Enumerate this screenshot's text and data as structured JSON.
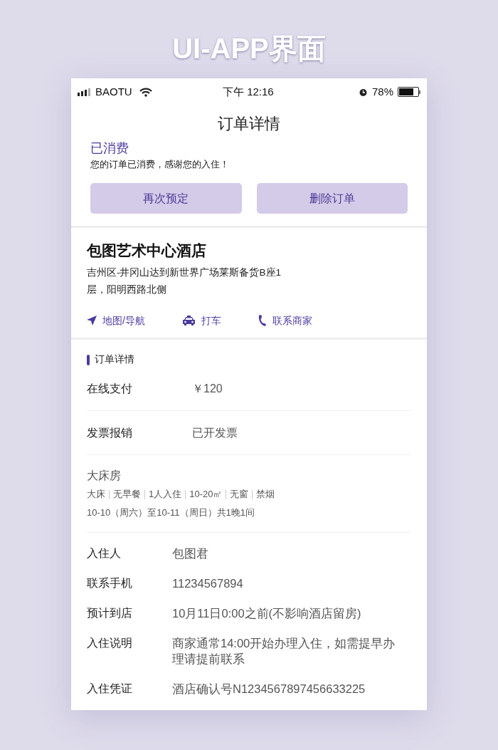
{
  "poster_title": "UI-APP界面",
  "status_bar": {
    "carrier": "BAOTU",
    "time": "下午 12:16",
    "battery": "78%"
  },
  "nav_title": "订单详情",
  "order_status": {
    "title": "已消费",
    "message": "您的订单已消费，感谢您的入住！"
  },
  "buttons": [
    "再次预定",
    "删除订单"
  ],
  "hotel": {
    "name": "包图艺术中心酒店",
    "address": "吉州区-井冈山达到新世界广场莱斯备货B座1层，阳明西路北侧"
  },
  "actions": [
    {
      "kind": "navigate",
      "label": "地图/导航"
    },
    {
      "kind": "taxi",
      "label": "打车"
    },
    {
      "kind": "phone",
      "label": "联系商家"
    }
  ],
  "section_title": "订单详情",
  "payment_rows": [
    {
      "label": "在线支付",
      "value": "￥120"
    },
    {
      "label": "发票报销",
      "value": "已开发票"
    }
  ],
  "room": {
    "name": "大床房",
    "tags": [
      "大床",
      "无早餐",
      "1人入住",
      "10-20㎡",
      "无窗",
      "禁烟"
    ],
    "dates": "10-10（周六）至10-11（周日）共1晚1间"
  },
  "guest_rows": [
    {
      "label": "入住人",
      "value": "包图君"
    },
    {
      "label": "联系手机",
      "value": "11234567894"
    },
    {
      "label": "预计到店",
      "value": "10月11日0:00之前(不影响酒店留房)"
    },
    {
      "label": "入住说明",
      "value": "商家通常14:00开始办理入住，如需提早办理请提前联系"
    },
    {
      "label": "入住凭证",
      "value": "酒店确认号N1234567897456633225"
    }
  ]
}
